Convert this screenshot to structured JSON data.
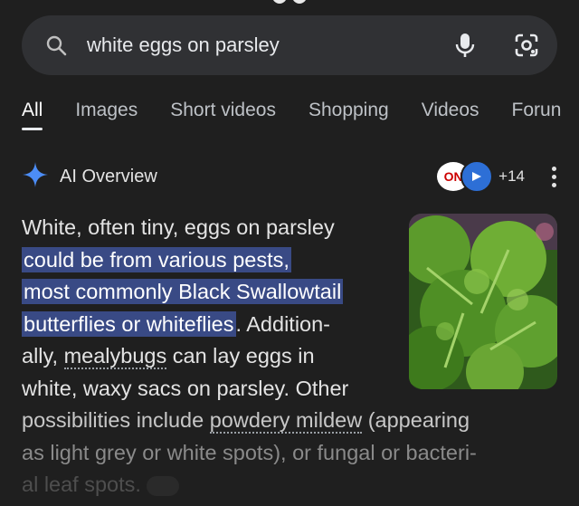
{
  "search": {
    "query": "white eggs on parsley"
  },
  "tabs": [
    {
      "label": "All",
      "active": true
    },
    {
      "label": "Images"
    },
    {
      "label": "Short videos"
    },
    {
      "label": "Shopping"
    },
    {
      "label": "Videos"
    },
    {
      "label": "Forun"
    }
  ],
  "ai_overview": {
    "title": "AI Overview",
    "source_count": "+14",
    "source_badge_text": "ON",
    "text": {
      "part1": "White, often tiny, eggs on parsley ",
      "hl1": "could be from various pests,",
      "hl2": "most commonly Black Swallowtail",
      "hl3": "butterflies or whiteflies",
      "part2": ". Addition-",
      "part3": "ally, ",
      "link1": "mealybugs",
      "part4": " can lay eggs in",
      "part5": "white, waxy sacs on parsley. Other",
      "part6": "possibilities include ",
      "link2": "powdery mildew",
      "part7": " (appearing",
      "part8": "as light grey or white spots), or fungal or bacteri-",
      "part9": "al leaf spots."
    }
  },
  "icons": {
    "search": "search-icon",
    "mic": "mic-icon",
    "lens": "lens-icon",
    "sparkle": "ai-sparkle-icon",
    "more": "more-vert-icon",
    "link": "link-icon"
  },
  "colors": {
    "background": "#1f1f1f",
    "search_bar": "#303134",
    "highlight": "#394a85",
    "sparkle": "#4c8df6"
  }
}
